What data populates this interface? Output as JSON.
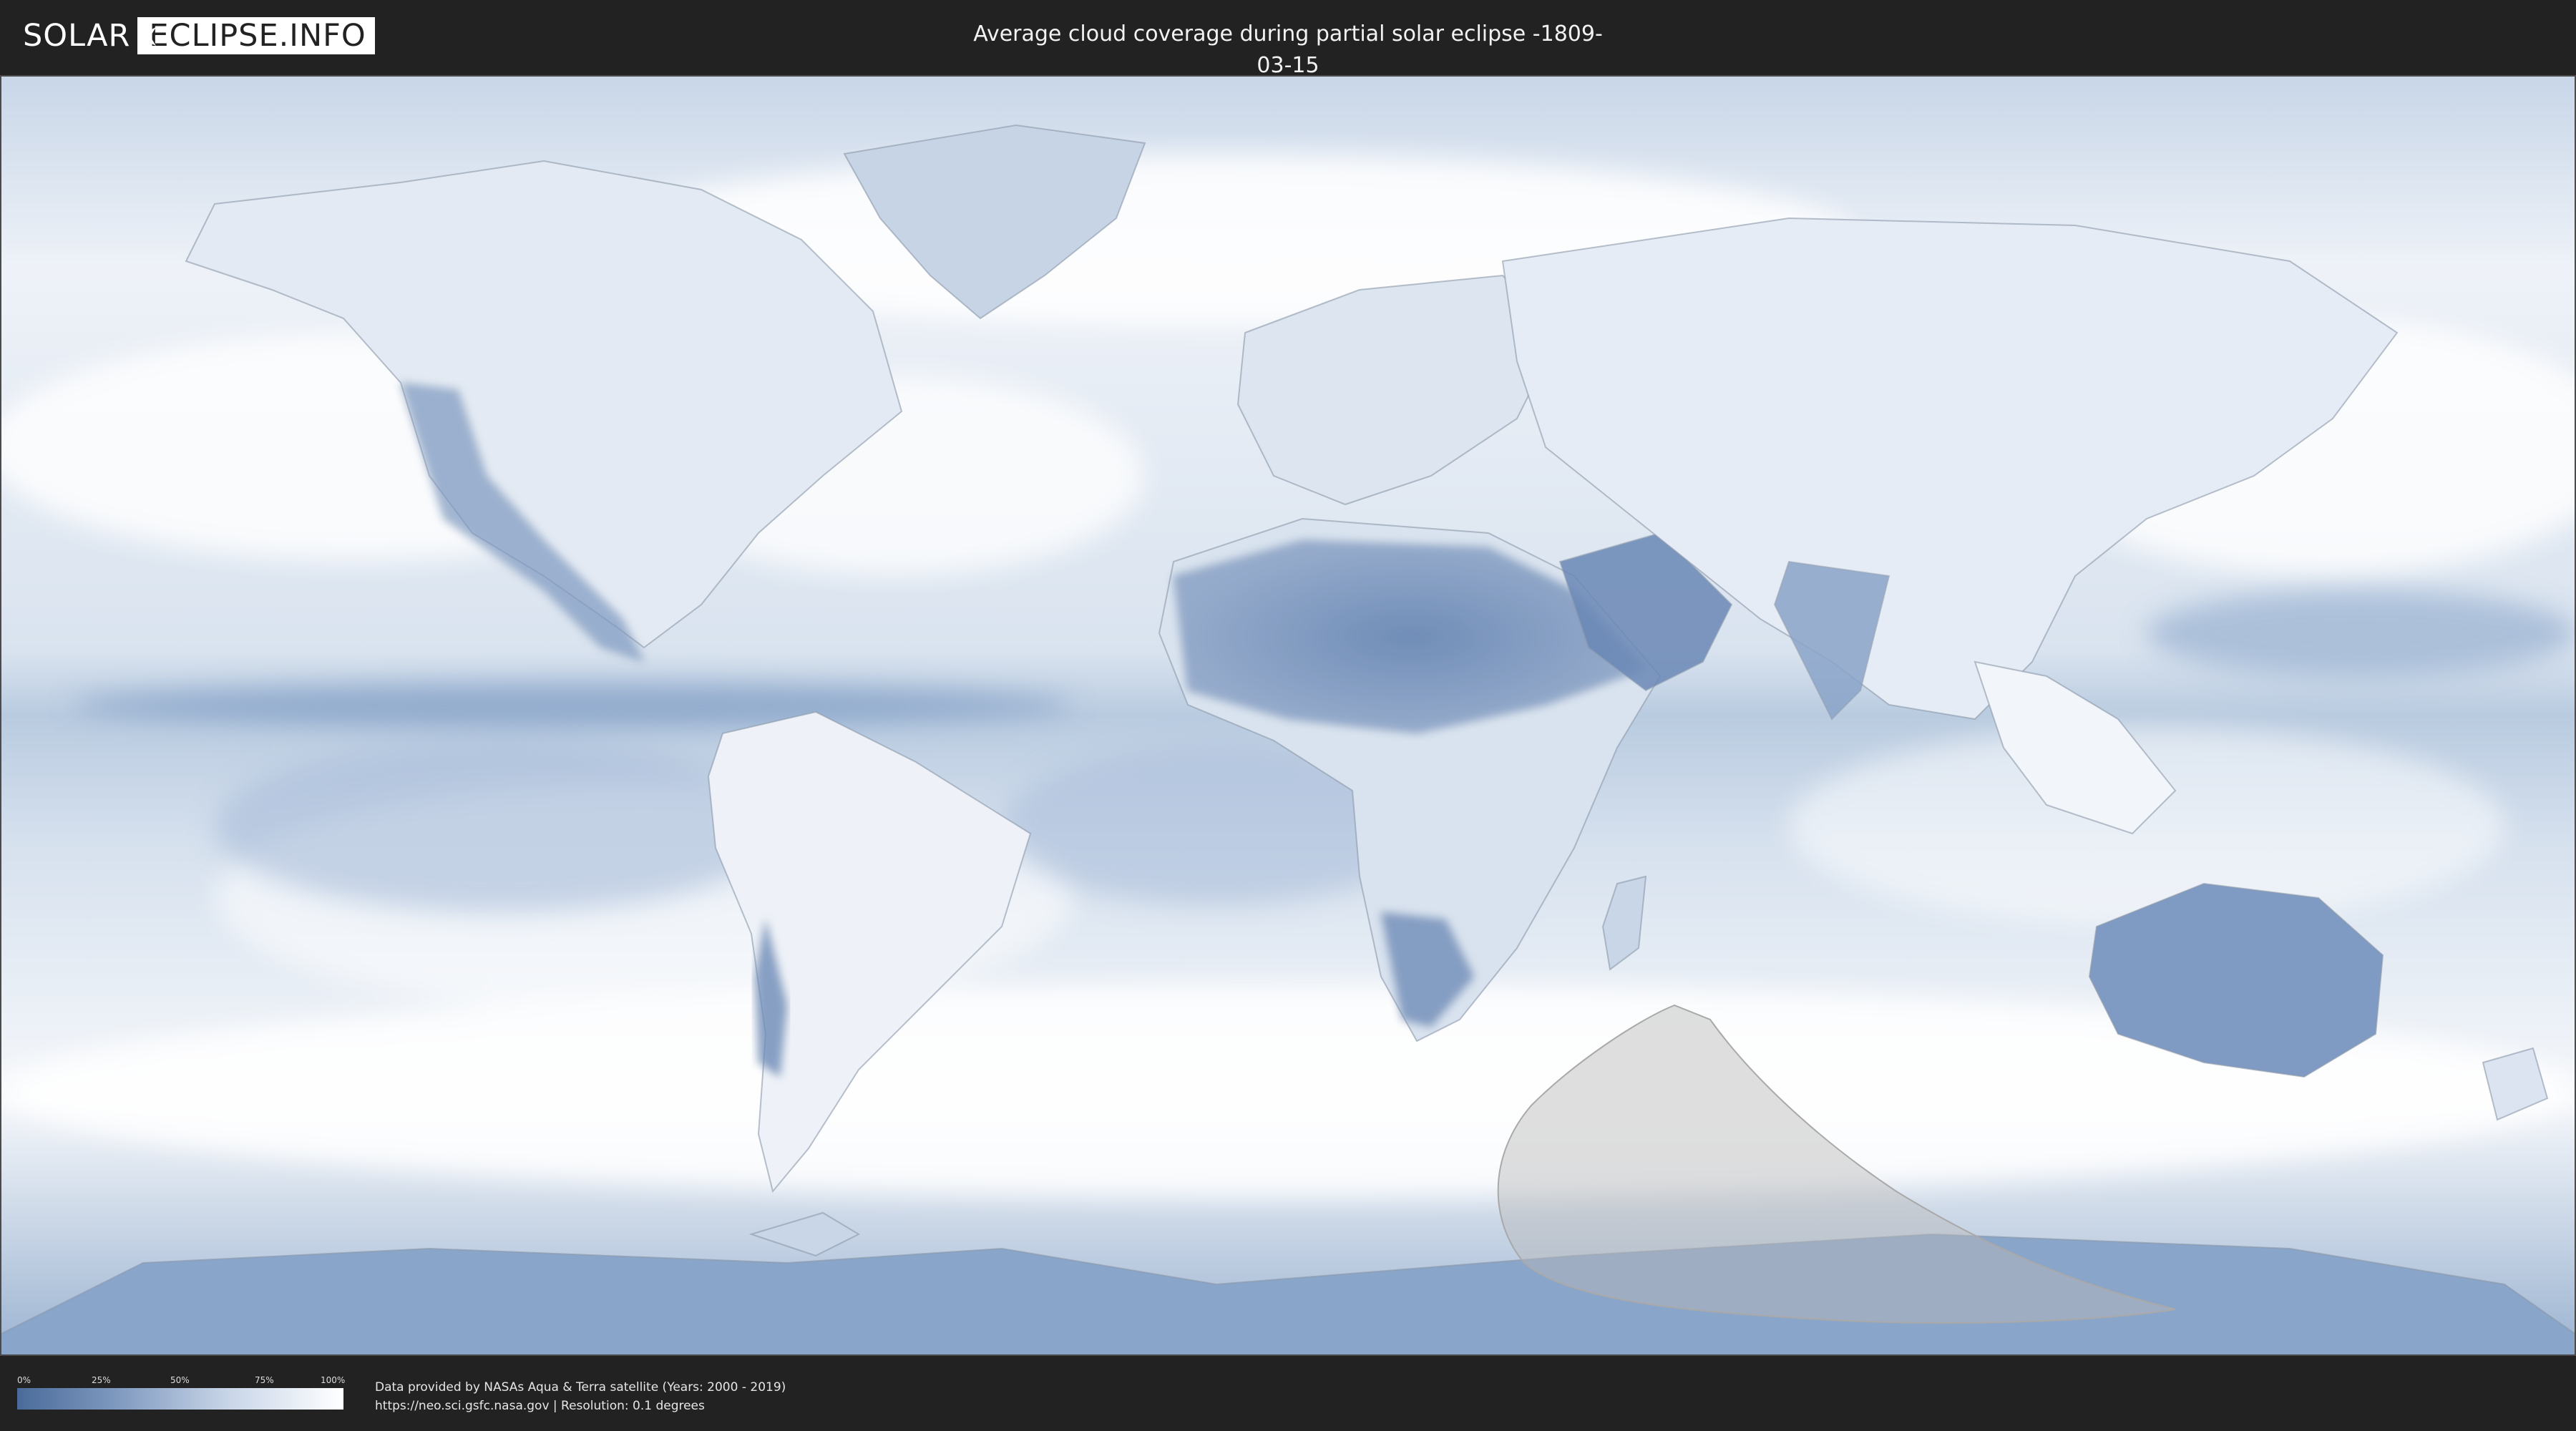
{
  "header": {
    "logo_left": "SOLAR",
    "logo_right": "ECLIPSE.INFO",
    "title": "Average cloud coverage during partial solar eclipse -1809-03-15"
  },
  "map": {
    "ocean_color": "#dfe7f1",
    "cloud_color": "#ffffff",
    "clear_sky_color": "#4a6b9a",
    "eclipse_overlay_color": "#b9b9b9",
    "icons": [
      "world-map",
      "eclipse-visibility-area"
    ]
  },
  "legend": {
    "ticks": [
      "0%",
      "25%",
      "50%",
      "75%",
      "100%"
    ],
    "gradient_colors": [
      "#4a6b9a",
      "#7e98bf",
      "#c9d6e8",
      "#ffffff"
    ]
  },
  "credits": {
    "line1": "Data provided by NASAs Aqua & Terra satellite (Years: 2000 - 2019)",
    "line2": "https://neo.sci.gsfc.nasa.gov | Resolution: 0.1 degrees"
  }
}
